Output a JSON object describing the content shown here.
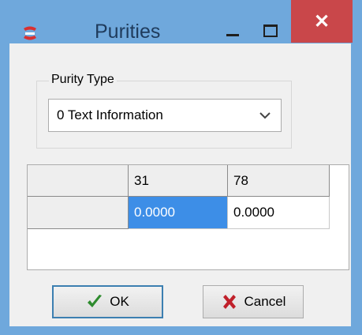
{
  "window": {
    "title": "Purities",
    "close_glyph": "✕"
  },
  "purity_group": {
    "label": "Purity Type",
    "selected": "0 Text Information"
  },
  "grid": {
    "headers": [
      "",
      "31",
      "78"
    ],
    "rows": [
      [
        "",
        "0.0000",
        "0.0000"
      ]
    ]
  },
  "buttons": {
    "ok_label": "OK",
    "cancel_label": "Cancel"
  },
  "icons": {
    "app": "delphi-app-icon",
    "ok": "check-icon",
    "cancel": "x-icon",
    "dropdown": "chevron-down-icon"
  },
  "colors": {
    "titlebar": "#6fa8dc",
    "close": "#c9474a",
    "selection": "#3d8ee7",
    "ok_check": "#2e8b2e",
    "cancel_x": "#c0202a"
  }
}
